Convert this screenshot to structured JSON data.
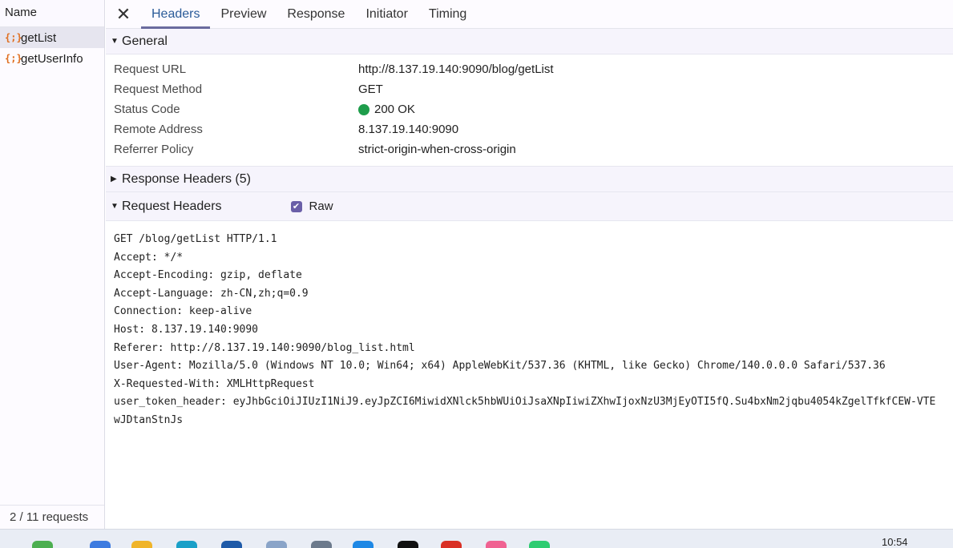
{
  "left": {
    "column_header": "Name",
    "requests": [
      {
        "icon": "{;}",
        "name": "getList",
        "selected": true
      },
      {
        "icon": "{;}",
        "name": "getUserInfo",
        "selected": false
      }
    ],
    "footer": "2 / 11 requests"
  },
  "tabs": [
    "Headers",
    "Preview",
    "Response",
    "Initiator",
    "Timing"
  ],
  "active_tab": "Headers",
  "general": {
    "title": "General",
    "rows": [
      {
        "key": "Request URL",
        "value": "http://8.137.19.140:9090/blog/getList"
      },
      {
        "key": "Request Method",
        "value": "GET"
      },
      {
        "key": "Status Code",
        "value": "200 OK"
      },
      {
        "key": "Remote Address",
        "value": "8.137.19.140:9090"
      },
      {
        "key": "Referrer Policy",
        "value": "strict-origin-when-cross-origin"
      }
    ]
  },
  "response_headers": {
    "title": "Response Headers (5)"
  },
  "request_headers": {
    "title": "Request Headers",
    "raw_label": "Raw",
    "raw_checked": true,
    "lines": [
      "GET /blog/getList HTTP/1.1",
      "Accept: */*",
      "Accept-Encoding: gzip, deflate",
      "Accept-Language: zh-CN,zh;q=0.9",
      "Connection: keep-alive",
      "Host: 8.137.19.140:9090",
      "Referer: http://8.137.19.140:9090/blog_list.html",
      "User-Agent: Mozilla/5.0 (Windows NT 10.0; Win64; x64) AppleWebKit/537.36 (KHTML, like Gecko) Chrome/140.0.0.0 Safari/537.36",
      "X-Requested-With: XMLHttpRequest",
      "user_token_header: eyJhbGciOiJIUzI1NiJ9.eyJpZCI6MiwidXNlck5hbWUiOiJsaXNpIiwiZXhwIjoxNzU3MjEyOTI5fQ.Su4bxNm2jqbu4054kZgelTfkfCEW-VTE",
      "wJDtanStnJs"
    ]
  },
  "taskbar": {
    "clock": "10:54",
    "icon_colors": [
      "#4caf50",
      "#3d7be0",
      "#f0b429",
      "#1aa0c8",
      "#1e5aa8",
      "#8aa4c8",
      "#6c7a8c",
      "#1e88e5",
      "#111111",
      "#d93025",
      "#f06292",
      "#2ecc71"
    ]
  }
}
